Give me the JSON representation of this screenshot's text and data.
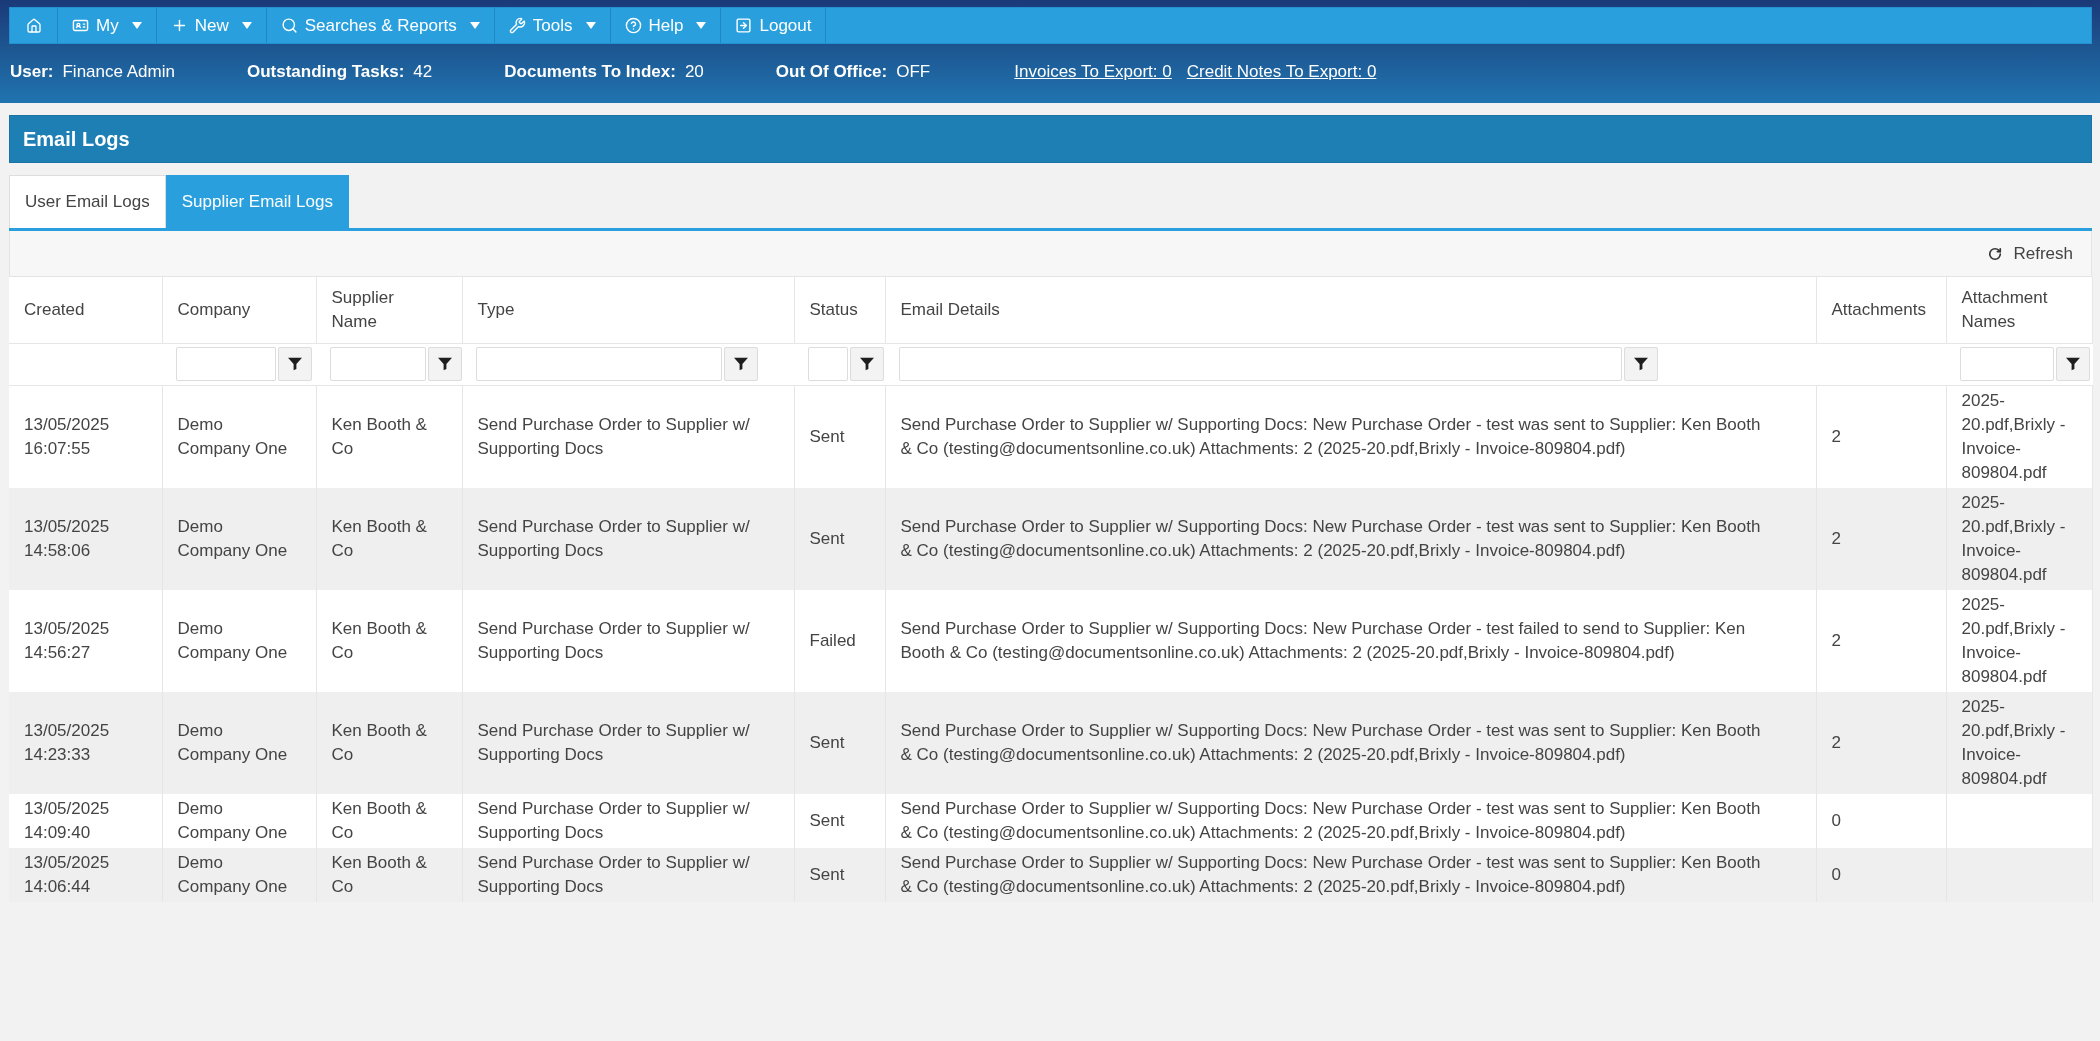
{
  "nav": {
    "items": [
      {
        "label": "My",
        "dropdown": true
      },
      {
        "label": "New",
        "dropdown": true
      },
      {
        "label": "Searches & Reports",
        "dropdown": true
      },
      {
        "label": "Tools",
        "dropdown": true
      },
      {
        "label": "Help",
        "dropdown": true
      },
      {
        "label": "Logout",
        "dropdown": false
      }
    ]
  },
  "status_bar": {
    "fields": [
      {
        "label": "User:",
        "value": "Finance Admin"
      },
      {
        "label": "Outstanding Tasks:",
        "value": "42"
      },
      {
        "label": "Documents To Index:",
        "value": "20"
      },
      {
        "label": "Out Of Office:",
        "value": "OFF"
      }
    ],
    "links": [
      "Invoices To Export: 0",
      "Credit Notes To Export: 0"
    ]
  },
  "panel": {
    "title": "Email Logs",
    "tabs": [
      {
        "label": "User Email Logs",
        "selected": false
      },
      {
        "label": "Supplier Email Logs",
        "selected": true
      }
    ],
    "toolbar": {
      "refresh_label": "Refresh"
    },
    "table": {
      "columns": [
        {
          "label": "Created",
          "filter": false
        },
        {
          "label": "Company",
          "filter": true
        },
        {
          "label": "Supplier Name",
          "filter": true
        },
        {
          "label": "Type",
          "filter": true
        },
        {
          "label": "Status",
          "filter": true
        },
        {
          "label": "Email Details",
          "filter": true
        },
        {
          "label": "Attachments",
          "filter": false
        },
        {
          "label": "Attachment Names",
          "filter": true
        }
      ],
      "rows": [
        {
          "created": "13/05/2025 16:07:55",
          "company": "Demo Company One",
          "supplier_name": "Ken Booth & Co",
          "type": "Send Purchase Order to Supplier w/ Supporting Docs",
          "status": "Sent",
          "email_details": "Send Purchase Order to Supplier w/ Supporting Docs: New Purchase Order - test was sent to Supplier: Ken Booth & Co (testing@documentsonline.co.uk) Attachments: 2 (2025-20.pdf,Brixly - Invoice-809804.pdf)",
          "attachments": "2",
          "attachment_names": "2025-20.pdf,Brixly - Invoice-809804.pdf"
        },
        {
          "created": "13/05/2025 14:58:06",
          "company": "Demo Company One",
          "supplier_name": "Ken Booth & Co",
          "type": "Send Purchase Order to Supplier w/ Supporting Docs",
          "status": "Sent",
          "email_details": "Send Purchase Order to Supplier w/ Supporting Docs: New Purchase Order - test was sent to Supplier: Ken Booth & Co (testing@documentsonline.co.uk) Attachments: 2 (2025-20.pdf,Brixly - Invoice-809804.pdf)",
          "attachments": "2",
          "attachment_names": "2025-20.pdf,Brixly - Invoice-809804.pdf"
        },
        {
          "created": "13/05/2025 14:56:27",
          "company": "Demo Company One",
          "supplier_name": "Ken Booth & Co",
          "type": "Send Purchase Order to Supplier w/ Supporting Docs",
          "status": "Failed",
          "email_details": "Send Purchase Order to Supplier w/ Supporting Docs: New Purchase Order - test failed to send to Supplier: Ken Booth & Co (testing@documentsonline.co.uk) Attachments: 2 (2025-20.pdf,Brixly - Invoice-809804.pdf)",
          "attachments": "2",
          "attachment_names": "2025-20.pdf,Brixly - Invoice-809804.pdf"
        },
        {
          "created": "13/05/2025 14:23:33",
          "company": "Demo Company One",
          "supplier_name": "Ken Booth & Co",
          "type": "Send Purchase Order to Supplier w/ Supporting Docs",
          "status": "Sent",
          "email_details": "Send Purchase Order to Supplier w/ Supporting Docs: New Purchase Order - test was sent to Supplier: Ken Booth & Co (testing@documentsonline.co.uk) Attachments: 2 (2025-20.pdf,Brixly - Invoice-809804.pdf)",
          "attachments": "2",
          "attachment_names": "2025-20.pdf,Brixly - Invoice-809804.pdf"
        },
        {
          "created": "13/05/2025 14:09:40",
          "company": "Demo Company One",
          "supplier_name": "Ken Booth & Co",
          "type": "Send Purchase Order to Supplier w/ Supporting Docs",
          "status": "Sent",
          "email_details": "Send Purchase Order to Supplier w/ Supporting Docs: New Purchase Order - test was sent to Supplier: Ken Booth & Co (testing@documentsonline.co.uk) Attachments: 2 (2025-20.pdf,Brixly - Invoice-809804.pdf)",
          "attachments": "0"
        },
        {
          "created": "13/05/2025 14:06:44",
          "company": "Demo Company One",
          "supplier_name": "Ken Booth & Co",
          "type": "Send Purchase Order to Supplier w/ Supporting Docs",
          "status": "Sent",
          "email_details": "Send Purchase Order to Supplier w/ Supporting Docs: New Purchase Order - test was sent to Supplier: Ken Booth & Co (testing@documentsonline.co.uk) Attachments: 2 (2025-20.pdf,Brixly - Invoice-809804.pdf)",
          "attachments": "0"
        }
      ]
    }
  }
}
